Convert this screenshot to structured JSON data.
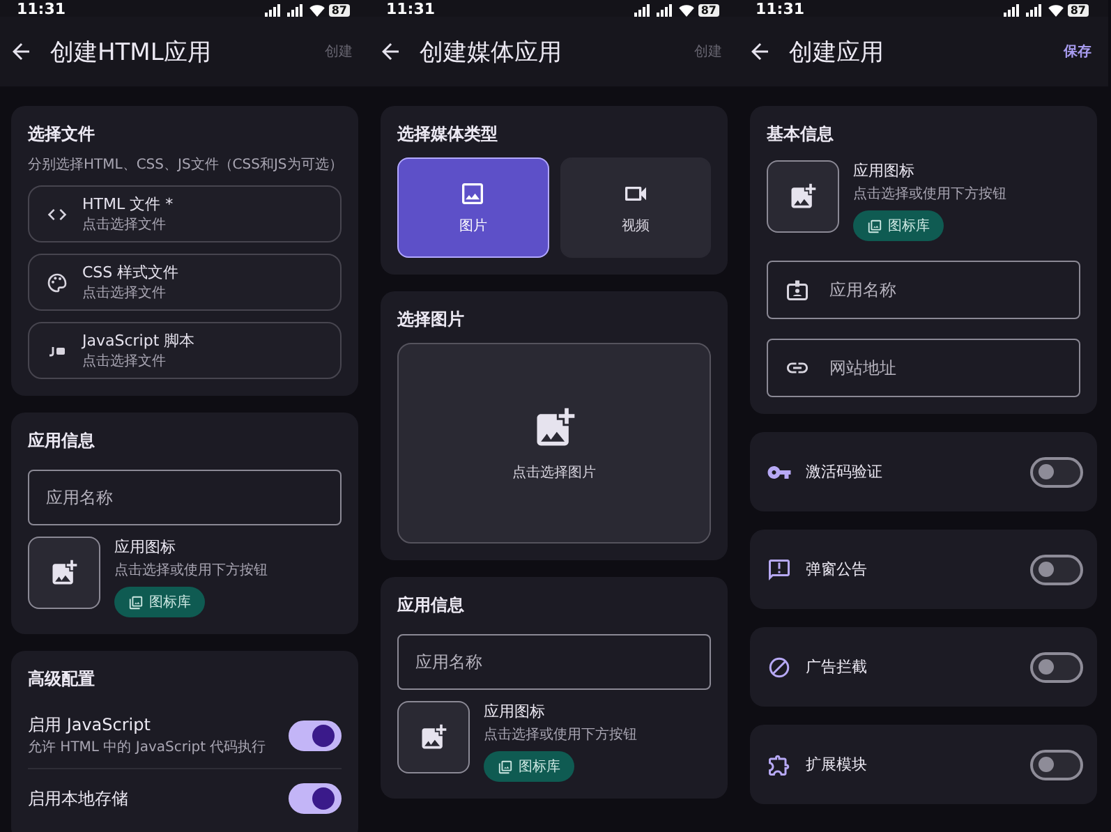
{
  "screens": [
    {
      "status_bar": {
        "time": "11:31",
        "battery": "87"
      },
      "title": "创建HTML应用",
      "action": {
        "label": "创建",
        "disabled": true
      },
      "sections": [
        {
          "kind": "files",
          "title": "选择文件",
          "subtitle": "分别选择HTML、CSS、JS文件（CSS和JS为可选）",
          "items": [
            {
              "kind": "code",
              "label": "HTML 文件 *",
              "hint": "点击选择文件"
            },
            {
              "kind": "palette",
              "label": "CSS 样式文件",
              "hint": "点击选择文件"
            },
            {
              "kind": "script",
              "label": "JavaScript 脚本",
              "hint": "点击选择文件"
            }
          ]
        },
        {
          "kind": "app_info",
          "title": "应用信息",
          "name_placeholder": "应用名称",
          "icon_label": "应用图标",
          "icon_hint": "点击选择或使用下方按钮",
          "library_button": "图标库"
        },
        {
          "kind": "settings",
          "title": "高级配置",
          "switches": [
            {
              "label": "启用 JavaScript",
              "hint": "允许 HTML 中的 JavaScript 代码执行",
              "on": true
            },
            {
              "label": "启用本地存储",
              "on": true
            }
          ]
        }
      ]
    },
    {
      "status_bar": {
        "time": "11:31",
        "battery": "87"
      },
      "title": "创建媒体应用",
      "action": {
        "label": "创建",
        "disabled": true
      },
      "sections": [
        {
          "kind": "media_type",
          "title": "选择媒体类型",
          "options": [
            {
              "kind": "image",
              "label": "图片",
              "selected": true
            },
            {
              "kind": "video",
              "label": "视频",
              "selected": false
            }
          ]
        },
        {
          "kind": "image_picker",
          "title": "选择图片",
          "hint": "点击选择图片"
        },
        {
          "kind": "app_info",
          "title": "应用信息",
          "name_placeholder": "应用名称",
          "icon_label": "应用图标",
          "icon_hint": "点击选择或使用下方按钮",
          "library_button": "图标库"
        }
      ]
    },
    {
      "status_bar": {
        "time": "11:31",
        "battery": "87"
      },
      "title": "创建应用",
      "action": {
        "label": "保存",
        "disabled": false
      },
      "sections": [
        {
          "kind": "basic_info",
          "title": "基本信息",
          "icon_label": "应用图标",
          "icon_hint": "点击选择或使用下方按钮",
          "library_button": "图标库",
          "fields": [
            {
              "kind": "badge",
              "placeholder": "应用名称"
            },
            {
              "kind": "link",
              "placeholder": "网站地址"
            }
          ]
        },
        {
          "kind": "toggles",
          "items": [
            {
              "kind": "key",
              "label": "激活码验证",
              "on": false
            },
            {
              "kind": "announcement",
              "label": "弹窗公告",
              "on": false
            },
            {
              "kind": "block",
              "label": "广告拦截",
              "on": false
            },
            {
              "kind": "puzzle",
              "label": "扩展模块",
              "on": false
            }
          ]
        }
      ]
    }
  ]
}
